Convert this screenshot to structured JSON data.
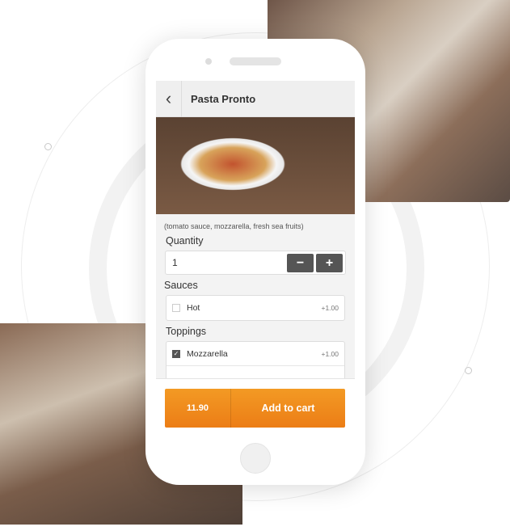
{
  "header": {
    "title": "Pasta Pronto",
    "back_icon": "chevron-left-icon"
  },
  "product": {
    "description": "(tomato sauce, mozzarella, fresh sea fruits)"
  },
  "quantity": {
    "label": "Quantity",
    "value": "1",
    "minus": "−",
    "plus": "+"
  },
  "sauces": {
    "label": "Sauces",
    "items": [
      {
        "name": "Hot",
        "price": "+1.00",
        "checked": false
      }
    ]
  },
  "toppings": {
    "label": "Toppings",
    "items": [
      {
        "name": "Mozzarella",
        "price": "+1.00",
        "checked": true
      }
    ]
  },
  "cart": {
    "total": "11.90",
    "add_label": "Add to cart",
    "color": "#ef8a1c"
  }
}
